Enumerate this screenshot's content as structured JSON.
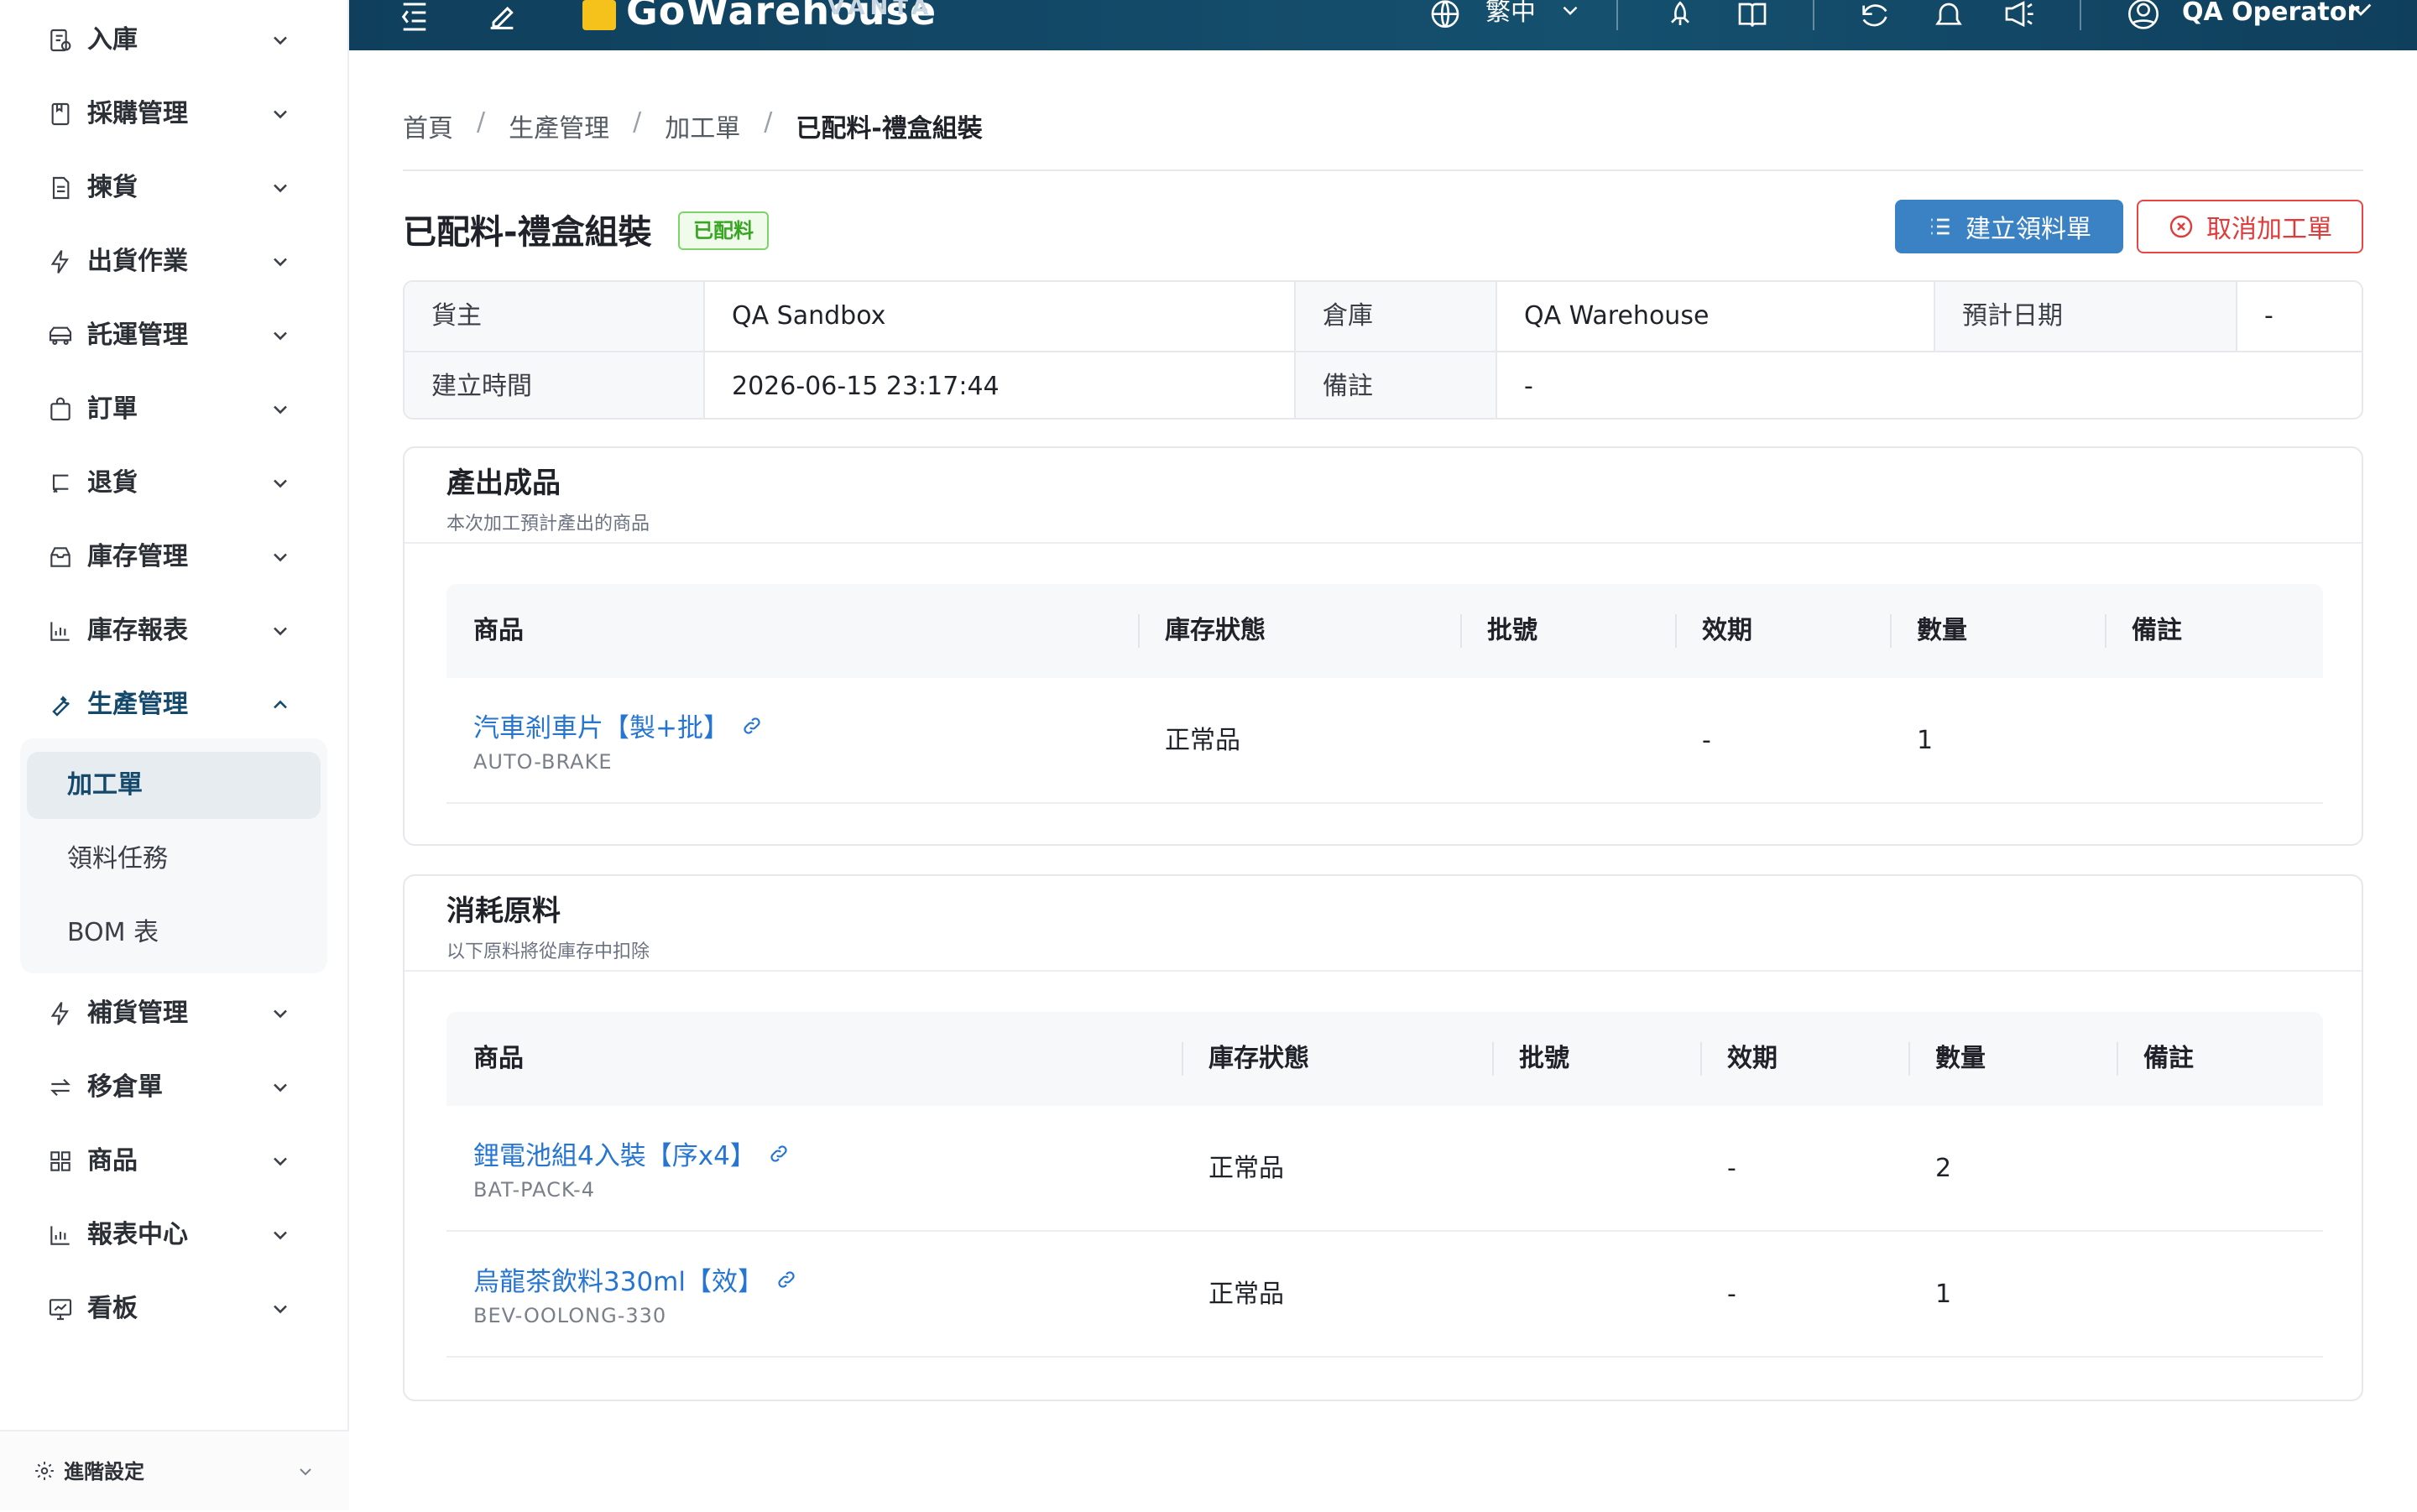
{
  "sidebar": {
    "items": [
      {
        "label": "入庫",
        "icon": "inbound-icon",
        "expanded": false
      },
      {
        "label": "採購管理",
        "icon": "purchase-icon",
        "expanded": false
      },
      {
        "label": "揀貨",
        "icon": "picking-icon",
        "expanded": false
      },
      {
        "label": "出貨作業",
        "icon": "shipping-icon",
        "expanded": false
      },
      {
        "label": "託運管理",
        "icon": "carrier-icon",
        "expanded": false
      },
      {
        "label": "訂單",
        "icon": "order-icon",
        "expanded": false
      },
      {
        "label": "退貨",
        "icon": "return-icon",
        "expanded": false
      },
      {
        "label": "庫存管理",
        "icon": "inventory-icon",
        "expanded": false
      },
      {
        "label": "庫存報表",
        "icon": "report-chart-icon",
        "expanded": false
      },
      {
        "label": "生產管理",
        "icon": "wrench-icon",
        "expanded": true
      },
      {
        "label": "補貨管理",
        "icon": "replenish-icon",
        "expanded": false
      },
      {
        "label": "移倉單",
        "icon": "transfer-icon",
        "expanded": false
      },
      {
        "label": "商品",
        "icon": "grid-icon",
        "expanded": false
      },
      {
        "label": "報表中心",
        "icon": "report-chart-icon",
        "expanded": false
      },
      {
        "label": "看板",
        "icon": "dashboard-icon",
        "expanded": false
      }
    ],
    "submenu": [
      {
        "label": "加工單",
        "selected": true
      },
      {
        "label": "領料任務",
        "selected": false
      },
      {
        "label": "BOM 表",
        "selected": false
      }
    ],
    "advanced_label": "進階設定"
  },
  "header": {
    "logo_text": "GoWarehouse",
    "logo_sub": "VANTA",
    "language": "繁中",
    "user": "QA Operator"
  },
  "breadcrumb": [
    "首頁",
    "生產管理",
    "加工單",
    "已配料-禮盒組裝"
  ],
  "page": {
    "title": "已配料-禮盒組裝",
    "status": "已配料",
    "create_pick_label": "建立領料單",
    "cancel_label": "取消加工單"
  },
  "info": {
    "owner_label": "貨主",
    "owner": "QA Sandbox",
    "warehouse_label": "倉庫",
    "warehouse": "QA Warehouse",
    "expected_label": "預計日期",
    "expected": "-",
    "created_label": "建立時間",
    "created": "2026-06-15 23:17:44",
    "note_label": "備註",
    "note": "-"
  },
  "output_section": {
    "title": "產出成品",
    "subtitle": "本次加工預計產出的商品",
    "columns": [
      "商品",
      "庫存狀態",
      "批號",
      "效期",
      "數量",
      "備註"
    ],
    "rows": [
      {
        "name": "汽車剎車片【製+批】",
        "sku": "AUTO-BRAKE",
        "status": "正常品",
        "lot": "",
        "expiry": "-",
        "qty": "1",
        "note": ""
      }
    ]
  },
  "material_section": {
    "title": "消耗原料",
    "subtitle": "以下原料將從庫存中扣除",
    "columns": [
      "商品",
      "庫存狀態",
      "批號",
      "效期",
      "數量",
      "備註"
    ],
    "rows": [
      {
        "name": "鋰電池組4入裝【序x4】",
        "sku": "BAT-PACK-4",
        "status": "正常品",
        "lot": "",
        "expiry": "-",
        "qty": "2",
        "note": ""
      },
      {
        "name": "烏龍茶飲料330ml【效】",
        "sku": "BEV-OOLONG-330",
        "status": "正常品",
        "lot": "",
        "expiry": "-",
        "qty": "1",
        "note": ""
      }
    ]
  },
  "colors": {
    "header_bg": "#14496b",
    "primary": "#3b82c4",
    "danger": "#e84545",
    "link": "#2676d1",
    "badge_green": "#38a622"
  }
}
